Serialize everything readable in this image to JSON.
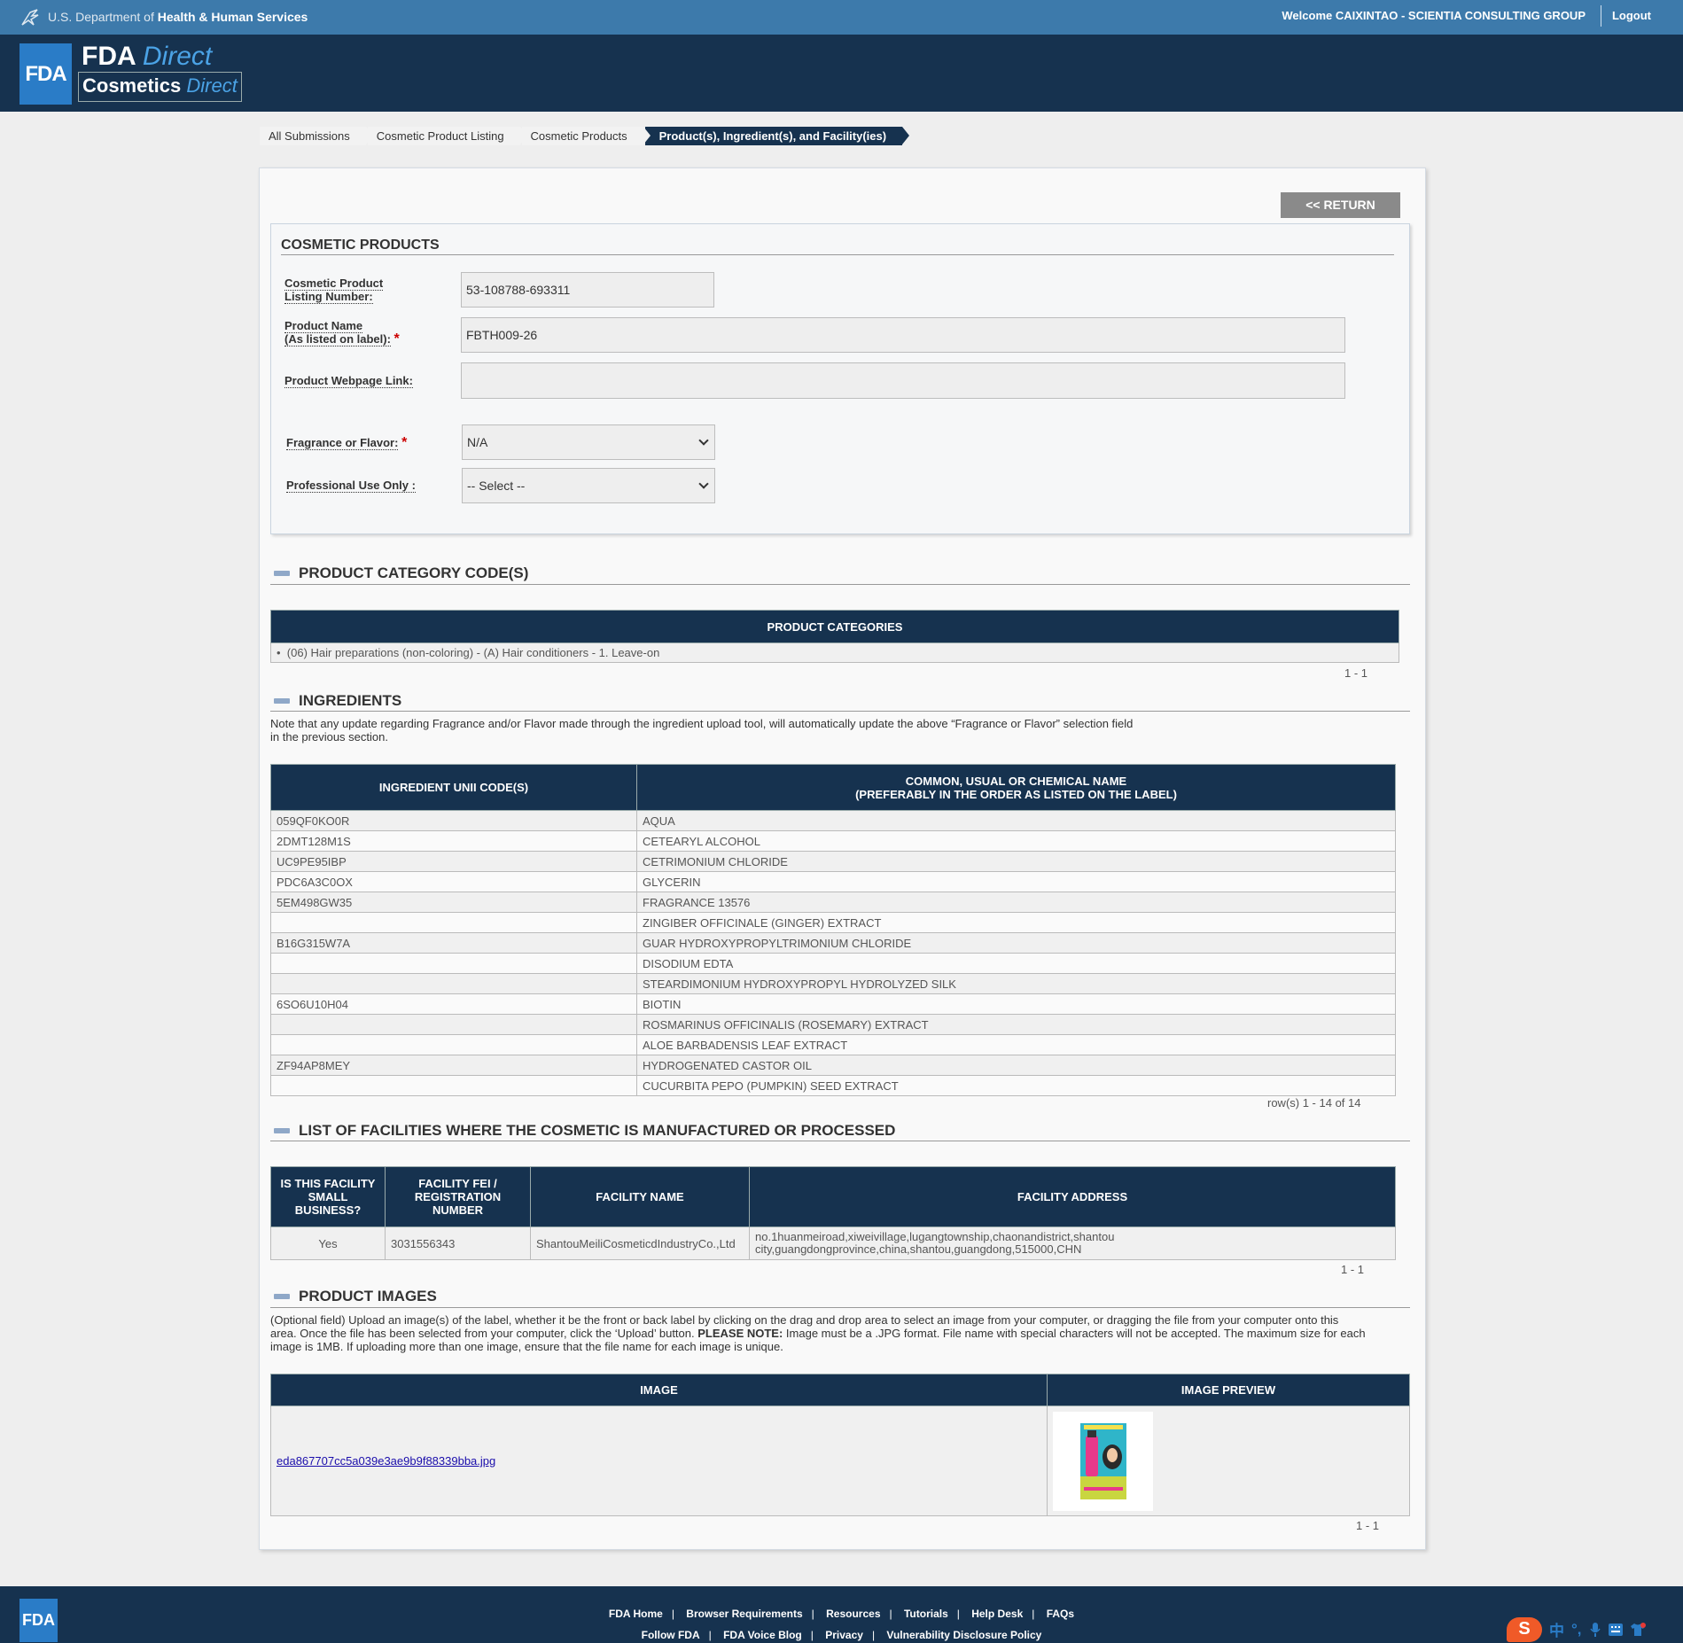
{
  "hhs": {
    "dept_prefix": "U.S. Department of ",
    "dept_name": "Health & Human Services",
    "welcome": "Welcome CAIXINTAO - SCIENTIA CONSULTING GROUP",
    "logout": "Logout"
  },
  "header": {
    "logo": "FDA",
    "fda": "FDA ",
    "fda_direct": "Direct",
    "cosmetics": "Cosmetics ",
    "cosmetics_direct": "Direct"
  },
  "breadcrumb": [
    "All Submissions",
    "Cosmetic Product Listing",
    "Cosmetic Products",
    "Product(s), Ingredient(s), and Facility(ies)"
  ],
  "return_label": "<< RETURN",
  "products": {
    "title": "COSMETIC PRODUCTS",
    "listing_label_1": "Cosmetic Product",
    "listing_label_2": "Listing Number:",
    "listing_value": "53-108788-693311",
    "name_label_1": "Product Name",
    "name_label_2": "(As listed on label):",
    "name_value": "FBTH009-26",
    "webpage_label": "Product Webpage Link:",
    "webpage_value": "",
    "fragrance_label": "Fragrance or Flavor:",
    "fragrance_value": "N/A",
    "professional_label": "Professional Use Only :",
    "professional_value": "-- Select --",
    "required_mark": "*"
  },
  "category": {
    "title": "PRODUCT CATEGORY CODE(S)",
    "header": "PRODUCT CATEGORIES",
    "item": "(06) Hair preparations (non-coloring) - (A) Hair conditioners - 1. Leave-on",
    "pager": "1 - 1"
  },
  "ingredients": {
    "title": "INGREDIENTS",
    "note_1": "Note that any update regarding Fragrance and/or Flavor made through the ingredient upload tool, will automatically update the above “Fragrance or Flavor” selection field",
    "note_2": "in the previous section.",
    "col1": "INGREDIENT UNII CODE(S)",
    "col2_1": "COMMON, USUAL OR CHEMICAL NAME",
    "col2_2": "(PREFERABLY IN THE ORDER AS LISTED ON THE LABEL)",
    "rows": [
      [
        "059QF0KO0R",
        "AQUA"
      ],
      [
        "2DMT128M1S",
        "CETEARYL ALCOHOL"
      ],
      [
        "UC9PE95IBP",
        "CETRIMONIUM CHLORIDE"
      ],
      [
        "PDC6A3C0OX",
        "GLYCERIN"
      ],
      [
        "5EM498GW35",
        "FRAGRANCE 13576"
      ],
      [
        "",
        "ZINGIBER OFFICINALE (GINGER) EXTRACT"
      ],
      [
        "B16G315W7A",
        "GUAR HYDROXYPROPYLTRIMONIUM CHLORIDE"
      ],
      [
        "",
        "DISODIUM EDTA"
      ],
      [
        "",
        "STEARDIMONIUM HYDROXYPROPYL HYDROLYZED SILK"
      ],
      [
        "6SO6U10H04",
        "BIOTIN"
      ],
      [
        "",
        "ROSMARINUS OFFICINALIS (ROSEMARY) EXTRACT"
      ],
      [
        "",
        "ALOE BARBADENSIS LEAF EXTRACT"
      ],
      [
        "ZF94AP8MEY",
        "HYDROGENATED CASTOR OIL"
      ],
      [
        "",
        "CUCURBITA PEPO (PUMPKIN) SEED EXTRACT"
      ]
    ],
    "pager": "row(s) 1 - 14 of 14"
  },
  "facilities": {
    "title": "LIST OF FACILITIES WHERE THE COSMETIC IS MANUFACTURED OR PROCESSED",
    "col1_1": "IS THIS FACILITY",
    "col1_2": "SMALL",
    "col1_3": "BUSINESS?",
    "col2_1": "FACILITY FEI /",
    "col2_2": "REGISTRATION",
    "col2_3": "NUMBER",
    "col3": "FACILITY NAME",
    "col4": "FACILITY ADDRESS",
    "small": "Yes",
    "fei": "3031556343",
    "name": "ShantouMeiliCosmeticdIndustryCo.,Ltd",
    "address_1": "no.1huanmeiroad,xiweivillage,lugangtownship,chaonandistrict,shantou",
    "address_2": "city,guangdongprovince,china,shantou,guangdong,515000,CHN",
    "pager": "1 - 1"
  },
  "images": {
    "title": "PRODUCT IMAGES",
    "note_1": "(Optional field) Upload an image(s) of the label, whether it be the front or back label by clicking on the drag and drop area to select an image from your computer, or dragging the file from your computer onto this",
    "note_2a": "area. Once the file has been selected from your computer, click the ‘Upload’ button. ",
    "note_2b": "PLEASE NOTE:",
    "note_2c": " Image must be a .JPG format. File name with special characters will not be accepted. The maximum size for each",
    "note_3": "image is 1MB. If uploading more than one image, ensure that the file name for each image is unique.",
    "col1": "IMAGE",
    "col2": "IMAGE PREVIEW",
    "file": "eda867707cc5a039e3ae9b9f88339bba.jpg",
    "pager": "1 - 1"
  },
  "footer": {
    "logo": "FDA",
    "row1": [
      "FDA Home",
      "Browser Requirements",
      "Resources",
      "Tutorials",
      "Help Desk",
      "FAQs"
    ],
    "row2": [
      "Follow FDA",
      "FDA Voice Blog",
      "Privacy",
      "Vulnerability Disclosure Policy"
    ],
    "sep": "|"
  },
  "ime": {
    "logo": "S",
    "lang": "中",
    "punct": "°,"
  }
}
